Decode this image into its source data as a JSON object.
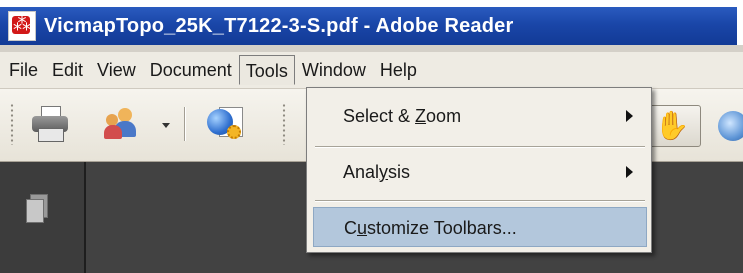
{
  "window": {
    "title": "VicmapTopo_25K_T7122-3-S.pdf - Adobe Reader",
    "app_icon": "pdf-icon"
  },
  "menubar": {
    "items": [
      {
        "label": "File"
      },
      {
        "label": "Edit"
      },
      {
        "label": "View"
      },
      {
        "label": "Document"
      },
      {
        "label": "Tools",
        "active": true
      },
      {
        "label": "Window"
      },
      {
        "label": "Help"
      }
    ]
  },
  "toolbar": {
    "icons": [
      "printer-icon",
      "users-icon",
      "globe-document-icon",
      "hand-tool-icon",
      "zoom-globe-icon"
    ]
  },
  "tools_menu": {
    "items": [
      {
        "pre": "Select & ",
        "accel": "Z",
        "post": "oom",
        "has_submenu": true
      },
      {
        "pre": "Anal",
        "accel": "y",
        "post": "sis",
        "has_submenu": true
      },
      {
        "pre": "C",
        "accel": "u",
        "post": "stomize Toolbars...",
        "has_submenu": false,
        "highlighted": true
      }
    ]
  },
  "side_panel": {
    "icons": [
      "pages-icon"
    ]
  },
  "colors": {
    "titlebar": "#1a46a8",
    "menu_highlight": "#b3c7dc",
    "content_bg": "#424242"
  }
}
